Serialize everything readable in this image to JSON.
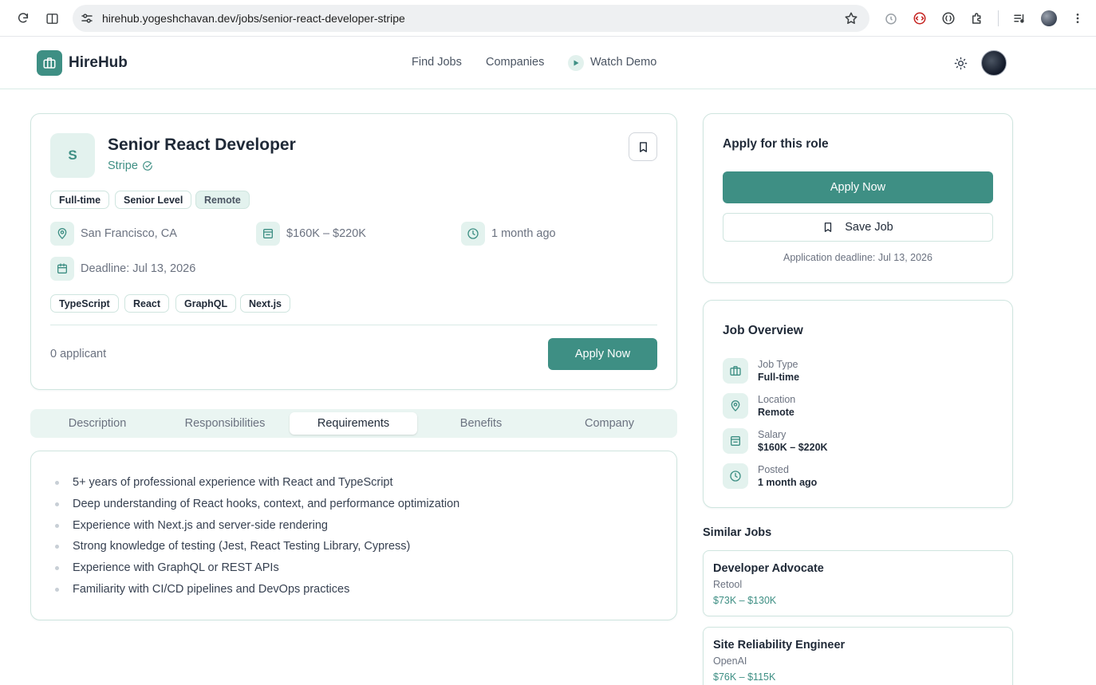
{
  "browser": {
    "url": "hirehub.yogeshchavan.dev/jobs/senior-react-developer-stripe"
  },
  "header": {
    "brand": "HireHub",
    "nav": {
      "find_jobs": "Find Jobs",
      "companies": "Companies",
      "watch_demo": "Watch Demo"
    }
  },
  "job": {
    "logo_letter": "S",
    "title": "Senior React Developer",
    "company": "Stripe",
    "tags": [
      "Full-time",
      "Senior Level",
      "Remote"
    ],
    "location": "San Francisco, CA",
    "salary": "$160K – $220K",
    "posted": "1 month ago",
    "deadline": "Deadline: Jul 13, 2026",
    "skills": [
      "TypeScript",
      "React",
      "GraphQL",
      "Next.js"
    ],
    "applicants": "0 applicant",
    "apply_label": "Apply Now"
  },
  "tabs": {
    "items": [
      "Description",
      "Responsibilities",
      "Requirements",
      "Benefits",
      "Company"
    ],
    "active": "Requirements"
  },
  "requirements": [
    "5+ years of professional experience with React and TypeScript",
    "Deep understanding of React hooks, context, and performance optimization",
    "Experience with Next.js and server-side rendering",
    "Strong knowledge of testing (Jest, React Testing Library, Cypress)",
    "Experience with GraphQL or REST APIs",
    "Familiarity with CI/CD pipelines and DevOps practices"
  ],
  "apply_card": {
    "title": "Apply for this role",
    "apply_label": "Apply Now",
    "save_label": "Save Job",
    "deadline_note": "Application deadline: Jul 13, 2026"
  },
  "overview": {
    "title": "Job Overview",
    "rows": [
      {
        "label": "Job Type",
        "value": "Full-time",
        "icon": "briefcase-icon"
      },
      {
        "label": "Location",
        "value": "Remote",
        "icon": "map-pin-icon"
      },
      {
        "label": "Salary",
        "value": "$160K – $220K",
        "icon": "wallet-icon"
      },
      {
        "label": "Posted",
        "value": "1 month ago",
        "icon": "clock-icon"
      }
    ]
  },
  "similar_jobs": {
    "title": "Similar Jobs",
    "items": [
      {
        "title": "Developer Advocate",
        "company": "Retool",
        "salary": "$73K – $130K"
      },
      {
        "title": "Site Reliability Engineer",
        "company": "OpenAI",
        "salary": "$76K – $115K"
      }
    ]
  },
  "colors": {
    "accent": "#3e8f84",
    "accent_light": "#e3f2ee",
    "border": "#cfe5df"
  }
}
